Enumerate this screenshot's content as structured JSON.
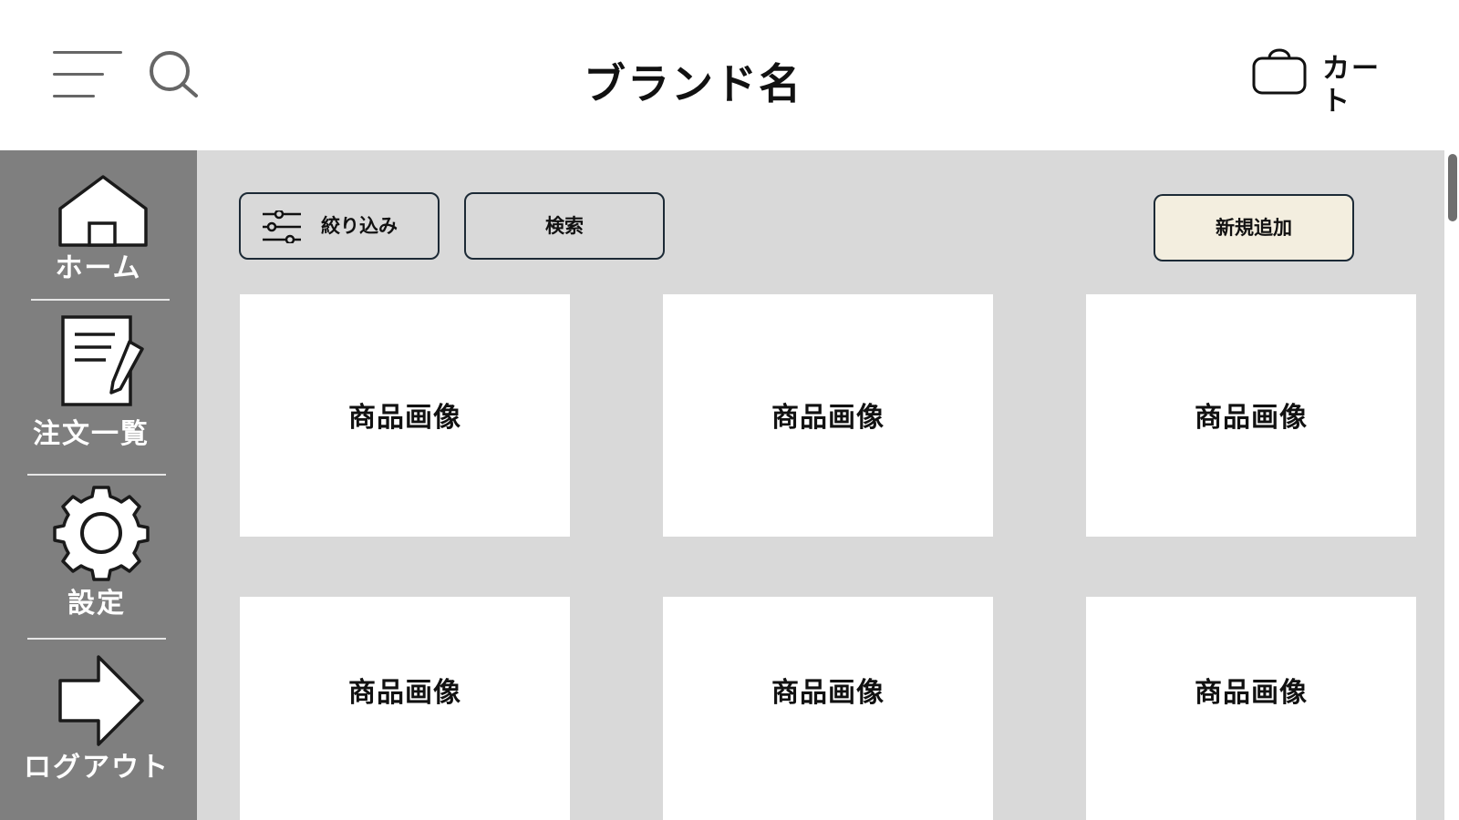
{
  "header": {
    "brand_name": "ブランド名",
    "cart_label": "カート",
    "menu_icon": "hamburger-menu-icon",
    "search_icon": "search-icon",
    "cart_icon": "shopping-bag-icon"
  },
  "sidebar": {
    "background": "#7f7f7f",
    "items": [
      {
        "label": "ホーム",
        "icon": "home-icon"
      },
      {
        "label": "注文一覧",
        "icon": "document-edit-icon"
      },
      {
        "label": "設定",
        "icon": "gear-icon"
      },
      {
        "label": "ログアウト",
        "icon": "arrow-right-icon"
      }
    ]
  },
  "toolbar": {
    "filter_label": "絞り込み",
    "filter_icon": "sliders-icon",
    "search_label": "検索",
    "add_label": "新規追加",
    "add_button_color": "#f3eedf"
  },
  "products": [
    {
      "image_label": "商品画像"
    },
    {
      "image_label": "商品画像"
    },
    {
      "image_label": "商品画像"
    },
    {
      "image_label": "商品画像"
    },
    {
      "image_label": "商品画像"
    },
    {
      "image_label": "商品画像"
    }
  ],
  "colors": {
    "content_bg": "#d9d9d9",
    "card_bg": "#ffffff",
    "border": "#1c2a36"
  }
}
